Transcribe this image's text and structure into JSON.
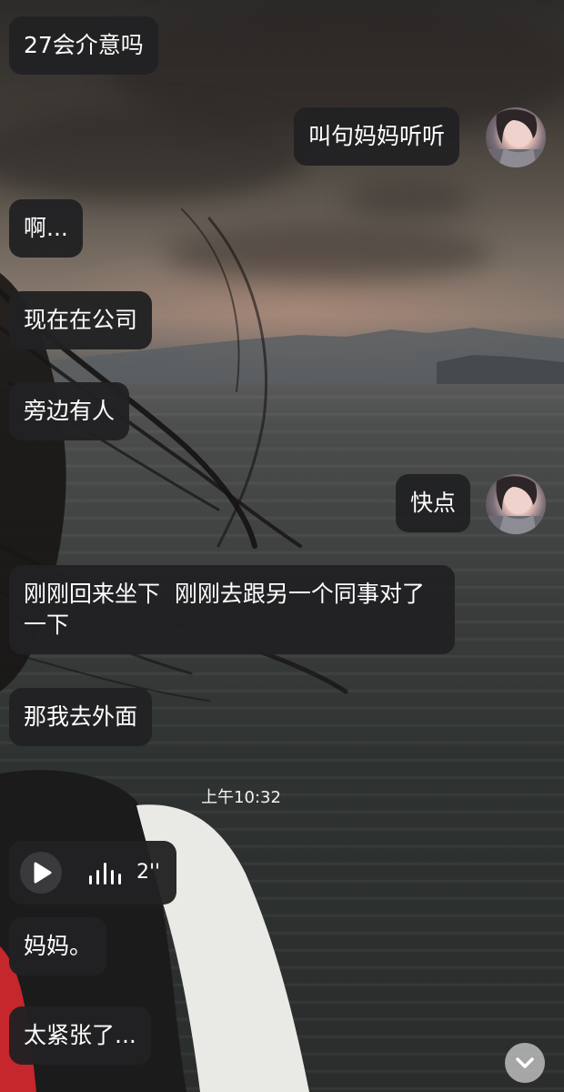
{
  "chat": {
    "messages": [
      {
        "side": "left",
        "text": "27会介意吗"
      },
      {
        "side": "right",
        "text": "叫句妈妈听听"
      },
      {
        "side": "left",
        "text": "啊..."
      },
      {
        "side": "left",
        "text": "现在在公司"
      },
      {
        "side": "left",
        "text": "旁边有人"
      },
      {
        "side": "right",
        "text": "快点"
      },
      {
        "side": "left",
        "text": "刚刚回来坐下  刚刚去跟另一个同事对了一下"
      },
      {
        "side": "left",
        "text": "那我去外面"
      },
      {
        "side": "left",
        "text": "妈妈。"
      },
      {
        "side": "left",
        "text": "太紧张了..."
      }
    ],
    "timestamp": "上午10:32",
    "voice_message": {
      "duration": "2''"
    }
  },
  "icons": {
    "play": "play-icon",
    "waveform": "waveform-icon",
    "scroll_down": "chevron-down-icon",
    "avatar": "user-avatar"
  },
  "colors": {
    "bubble_bg": "#212123",
    "bubble_text": "#ffffff",
    "timestamp_text": "#f2f2f2"
  }
}
